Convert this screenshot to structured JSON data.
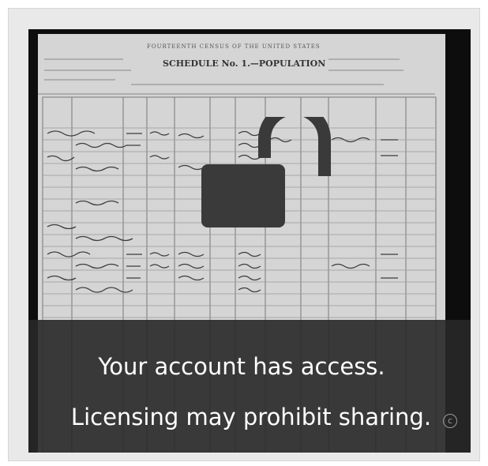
{
  "document": {
    "form_title": "SCHEDULE No. 1.—POPULATION",
    "form_heading": "FOURTEENTH CENSUS OF THE UNITED STATES"
  },
  "lock": {
    "icon": "unlocked-padlock-icon",
    "color": "#3a3a3a"
  },
  "banner": {
    "line1": "Your account has access.",
    "line2": "Licensing may prohibit sharing.",
    "copyright_symbol": "c"
  }
}
